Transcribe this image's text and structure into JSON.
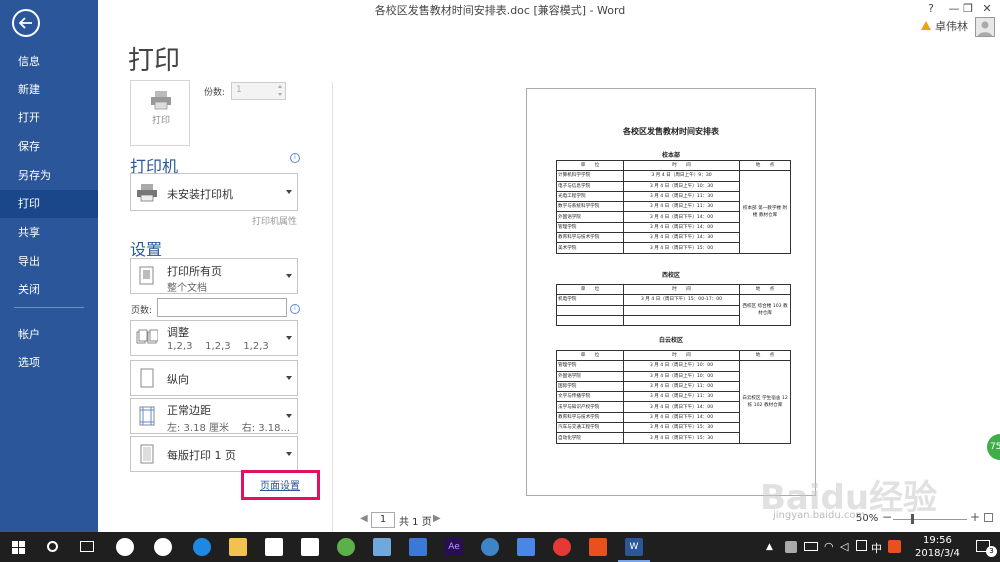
{
  "app": {
    "title": "各校区发售教材时间安排表.doc [兼容模式] - Word",
    "help": "?",
    "window_buttons": [
      "—",
      "❐",
      "✕"
    ],
    "user_name": "卓伟林"
  },
  "nav": {
    "items": [
      "信息",
      "新建",
      "打开",
      "保存",
      "另存为",
      "打印",
      "共享",
      "导出",
      "关闭",
      "帐户",
      "选项"
    ],
    "active": "打印"
  },
  "print": {
    "heading": "打印",
    "print_button": "打印",
    "copies_label": "份数:",
    "copies_value": "1",
    "printer_heading": "打印机",
    "printer_name": "未安装打印机",
    "printer_props": "打印机属性",
    "settings_heading": "设置",
    "range_main": "打印所有页",
    "range_sub": "整个文档",
    "pages_label": "页数:",
    "collate_main": "调整",
    "collate_sub": "1,2,3    1,2,3    1,2,3",
    "orientation": "纵向",
    "margins_main": "正常边距",
    "margins_sub": "左: 3.18 厘米    右: 3.18...",
    "per_sheet": "每版打印 1 页",
    "page_setup": "页面设置"
  },
  "preview": {
    "doc_title": "各校区发售教材时间安排表",
    "sections": [
      {
        "name": "校本部",
        "headers": [
          "单　　位",
          "时　　间",
          "地　　点"
        ],
        "rows": [
          [
            "计算机科学学院",
            "3 月 4 日（周日上午）9：30"
          ],
          [
            "电子与信息学院",
            "3 月 4 日（周日上午）10：30"
          ],
          [
            "光电工程学院",
            "3 月 4 日（周日上午）11：30"
          ],
          [
            "数学与系统科学学院",
            "3 月 4 日（周日上午）11：30"
          ],
          [
            "外国语学院",
            "3 月 4 日（周日下午）14：00"
          ],
          [
            "管理学院",
            "3 月 4 日（周日下午）14：00"
          ],
          [
            "教育科学与技术学院",
            "3 月 4 日（周日下午）14：30"
          ],
          [
            "美术学院",
            "3 月 4 日（周日下午）15：00"
          ]
        ],
        "place": "校本部 第一教学楼 附楼 教材仓库"
      },
      {
        "name": "西校区",
        "headers": [
          "单　　位",
          "时　　间",
          "地　　点"
        ],
        "rows": [
          [
            "机电学院",
            "3 月 4 日（周日下午）15：00-17：00"
          ],
          [
            "",
            ""
          ],
          [
            "",
            ""
          ]
        ],
        "place": "西校区 综合楼 103 教材仓库"
      },
      {
        "name": "白云校区",
        "headers": [
          "单　　位",
          "时　　间",
          "地　　点"
        ],
        "rows": [
          [
            "管理学院",
            "3 月 4 日（周日上午）10：00"
          ],
          [
            "外国语学院",
            "3 月 4 日（周日上午）10：00"
          ],
          [
            "国际学院",
            "3 月 4 日（周日上午）11：00"
          ],
          [
            "文学与传播学院",
            "3 月 4 日（周日上午）11：30"
          ],
          [
            "法学与知识产权学院",
            "3 月 4 日（周日下午）14：00"
          ],
          [
            "教育科学与技术学院",
            "3 月 4 日（周日下午）14：00"
          ],
          [
            "汽车与交通工程学院",
            "3 月 4 日（周日下午）15：30"
          ],
          [
            "自动化学院",
            "3 月 4 日（周日下午）15：30"
          ]
        ],
        "place": "白云校区 学生宿舍 12 栋 102 教材仓库"
      }
    ]
  },
  "pager": {
    "current": "1",
    "total": "共 1 页",
    "zoom": "50%",
    "zoom_minus": "−",
    "zoom_plus": "+"
  },
  "watermark": {
    "brand": "Baidu经验",
    "url": "jingyan.baidu.com"
  },
  "badge": "75",
  "taskbar": {
    "ime": "中",
    "time": "19:56",
    "date": "2018/3/4",
    "notify_count": "3",
    "colors": {
      "taskbar": "#1f1f1f",
      "accent": "#2b579a",
      "highlight": "#e0115f"
    }
  }
}
